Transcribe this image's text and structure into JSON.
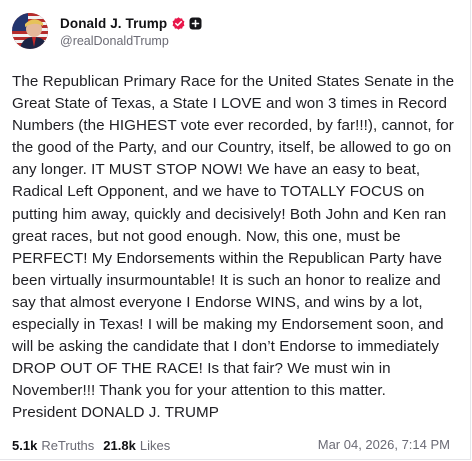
{
  "author": {
    "display_name": "Donald J. Trump",
    "handle": "@realDonaldTrump",
    "verified_badge_icon": "verified-badge-icon",
    "plus_icon": "plus-square-icon",
    "avatar_icon": "avatar-flag-portrait"
  },
  "post": {
    "body": "The Republican Primary Race for the United States Senate in the\nGreat State of Texas, a State I LOVE and won 3 times in Record\nNumbers (the HIGHEST vote ever recorded, by far!!!), cannot, for\nthe good of the Party, and our Country, itself, be allowed to go on\nany longer. IT MUST STOP NOW! We have an easy to beat,\nRadical Left Opponent, and we have to TOTALLY FOCUS on\nputting him away, quickly and decisively! Both John and Ken ran\ngreat races, but not good enough. Now, this one, must be\nPERFECT! My Endorsements within the Republican Party have\nbeen virtually insurmountable! It is such an honor to realize and\nsay that almost everyone I Endorse WINS, and wins by a lot,\nespecially in Texas! I will be making my Endorsement soon, and\nwill be asking the candidate that I don’t Endorse to immediately\nDROP OUT OF THE RACE! Is that fair? We must win in\nNovember!!! Thank you for your attention to this matter.\nPresident DONALD J. TRUMP"
  },
  "stats": {
    "retruths_count": "5.1k",
    "retruths_label": "ReTruths",
    "likes_count": "21.8k",
    "likes_label": "Likes"
  },
  "timestamp": "Mar 04, 2026, 7:14 PM",
  "colors": {
    "badge": "#e8174a",
    "text": "#1f1f24",
    "muted": "#6b6b75"
  }
}
